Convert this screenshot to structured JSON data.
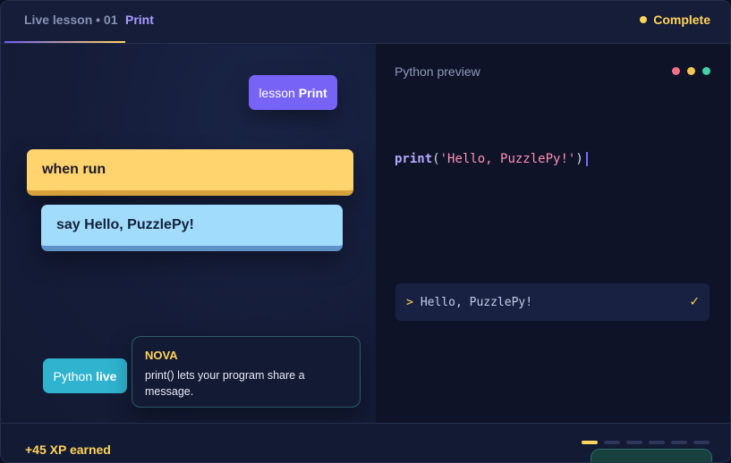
{
  "header": {
    "breadcrumb": "Live lesson • 01",
    "title": "Print",
    "status": "Complete"
  },
  "editor": {
    "lesson_chip": {
      "prefix": "lesson",
      "strong": "Print"
    },
    "blocks": [
      {
        "label": "when run",
        "color": "#ffd36e"
      },
      {
        "label": "say Hello, PuzzlePy!",
        "color": "#a2dcfd"
      }
    ],
    "live_chip": {
      "prefix": "Python",
      "strong": "live"
    },
    "tip": {
      "name": "NOVA",
      "message": "print() lets your program share a message."
    }
  },
  "preview": {
    "title": "Python preview",
    "window_dots": [
      "#f0708b",
      "#f5c451",
      "#45d0a8"
    ],
    "code": {
      "fn": "print",
      "open": "(",
      "string": "'Hello, PuzzlePy!'",
      "close": ")"
    },
    "console": {
      "prompt": ">",
      "output": "Hello, PuzzlePy!",
      "check": "✓"
    }
  },
  "footer": {
    "xp": "+45 XP earned",
    "steps_total": 6,
    "steps_active": 1
  }
}
